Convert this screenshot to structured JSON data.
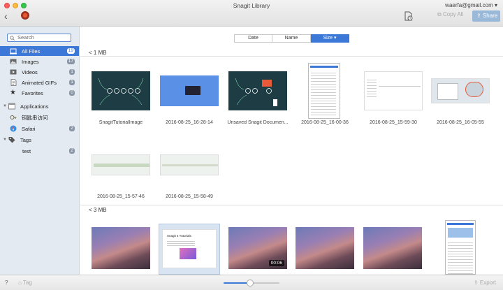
{
  "window": {
    "title": "Snagit Library",
    "account": "waerfa@gmail.com ▾"
  },
  "toolbar": {
    "copy_all_label": "Copy All",
    "share_label": "Share"
  },
  "sidebar": {
    "search_placeholder": "Search",
    "items": [
      {
        "label": "All Files",
        "count": "19",
        "icon": "all-files-icon"
      },
      {
        "label": "Images",
        "count": "17",
        "icon": "images-icon"
      },
      {
        "label": "Videos",
        "count": "1",
        "icon": "videos-icon"
      },
      {
        "label": "Animated GIFs",
        "count": "1",
        "icon": "gif-icon"
      },
      {
        "label": "Favorites",
        "count": "0",
        "icon": "star-icon"
      }
    ],
    "applications": {
      "label": "Applications",
      "items": [
        {
          "label": "钥匙串访问",
          "count": "",
          "icon": "keychain-icon"
        },
        {
          "label": "Safari",
          "count": "2",
          "icon": "safari-icon"
        }
      ]
    },
    "tags": {
      "label": "Tags",
      "items": [
        {
          "label": "test",
          "count": "2"
        }
      ]
    }
  },
  "sort": {
    "date": "Date",
    "name": "Name",
    "size": "Size ▾"
  },
  "groups": [
    {
      "header": "< 1 MB",
      "items": [
        {
          "label": "SnagitTutorialImage"
        },
        {
          "label": "2016-08-25_16-28-14"
        },
        {
          "label": "Unsaved Snagit Documen..."
        },
        {
          "label": "2016-08-25_16-00-36"
        },
        {
          "label": "2016-08-25_15-59-30"
        },
        {
          "label": "2016-08-25_16-05-55"
        },
        {
          "label": "2016-08-25_15-57-46"
        },
        {
          "label": "2016-08-25_15-58-49"
        }
      ]
    },
    {
      "header": "< 3 MB",
      "items": [
        {
          "label": ""
        },
        {
          "label": "",
          "caption": "Snagit 4 Tutorials"
        },
        {
          "label": "",
          "duration": "00:06"
        },
        {
          "label": ""
        },
        {
          "label": ""
        },
        {
          "label": ""
        }
      ]
    }
  ],
  "bottom": {
    "help": "?",
    "tag_label": "Tag",
    "export_label": "Export",
    "zoom_level": 0.48
  },
  "colors": {
    "accent": "#3b78d8",
    "sidebar_bg": "#e4eaf2"
  }
}
